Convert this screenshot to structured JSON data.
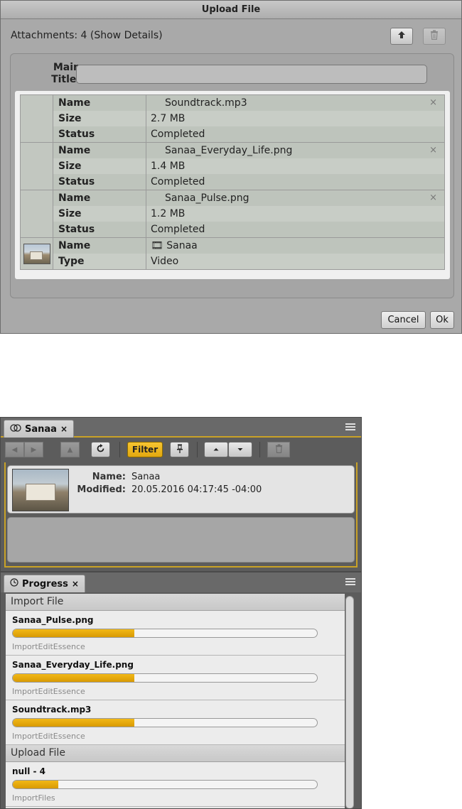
{
  "upload_dialog": {
    "title": "Upload File",
    "attachments_text": "Attachments: 4 (Show Details)",
    "main_title_label": "Main Title:",
    "main_title_value": "",
    "files": [
      {
        "rows": [
          {
            "key": "Name",
            "value": "Soundtrack.mp3"
          },
          {
            "key": "Size",
            "value": "2.7 MB"
          },
          {
            "key": "Status",
            "value": "Completed"
          }
        ],
        "removable": true
      },
      {
        "rows": [
          {
            "key": "Name",
            "value": "Sanaa_Everyday_Life.png"
          },
          {
            "key": "Size",
            "value": "1.4 MB"
          },
          {
            "key": "Status",
            "value": "Completed"
          }
        ],
        "removable": true
      },
      {
        "rows": [
          {
            "key": "Name",
            "value": "Sanaa_Pulse.png"
          },
          {
            "key": "Size",
            "value": "1.2 MB"
          },
          {
            "key": "Status",
            "value": "Completed"
          }
        ],
        "removable": true
      },
      {
        "rows": [
          {
            "key": "Name",
            "value": "🎞 Sanaa"
          },
          {
            "key": "Type",
            "value": "Video"
          }
        ],
        "removable": false,
        "thumb": true
      }
    ],
    "remove_glyph": "×",
    "cancel_label": "Cancel",
    "ok_label": "Ok",
    "icons": {
      "upload": "upload-arrow-icon",
      "trash": "trash-icon"
    }
  },
  "sanaa_panel": {
    "tab_label": "Sanaa",
    "tab_close": "×",
    "filter_label": "Filter",
    "name_key": "Name:",
    "name_value": "Sanaa",
    "modified_key": "Modified:",
    "modified_value": "20.05.2016 04:17:45 -04:00",
    "accent_color": "#c9a227"
  },
  "progress_panel": {
    "tab_label": "Progress",
    "tab_close": "×",
    "groups": [
      {
        "title": "Import File",
        "items": [
          {
            "name": "Sanaa_Pulse.png",
            "task": "ImportEditEssence",
            "progress": 0.4
          },
          {
            "name": "Sanaa_Everyday_Life.png",
            "task": "ImportEditEssence",
            "progress": 0.4
          },
          {
            "name": "Soundtrack.mp3",
            "task": "ImportEditEssence",
            "progress": 0.4
          }
        ]
      },
      {
        "title": "Upload File",
        "items": [
          {
            "name": "null - 4",
            "task": "ImportFiles",
            "progress": 0.15
          }
        ]
      }
    ],
    "progress_color": "#e3a70a"
  }
}
